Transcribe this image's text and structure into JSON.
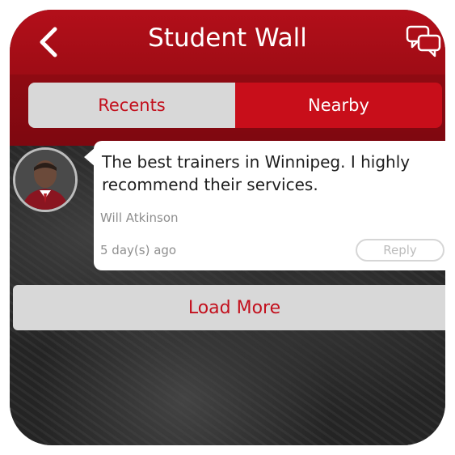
{
  "header": {
    "title": "Student Wall",
    "back_icon": "chevron-left-icon",
    "chat_icon": "chat-bubbles-icon"
  },
  "tabs": [
    {
      "label": "Recents",
      "selected": true
    },
    {
      "label": "Nearby",
      "selected": false
    }
  ],
  "posts": [
    {
      "text": "The best trainers in Winnipeg.  I highly recommend their services.",
      "author": "Will Atkinson",
      "timestamp": "5 day(s) ago",
      "reply_label": "Reply"
    }
  ],
  "load_more_label": "Load More",
  "colors": {
    "brand_red": "#b30f1a",
    "tab_inactive": "#d8d8d8",
    "background": "#2b2b2b"
  }
}
